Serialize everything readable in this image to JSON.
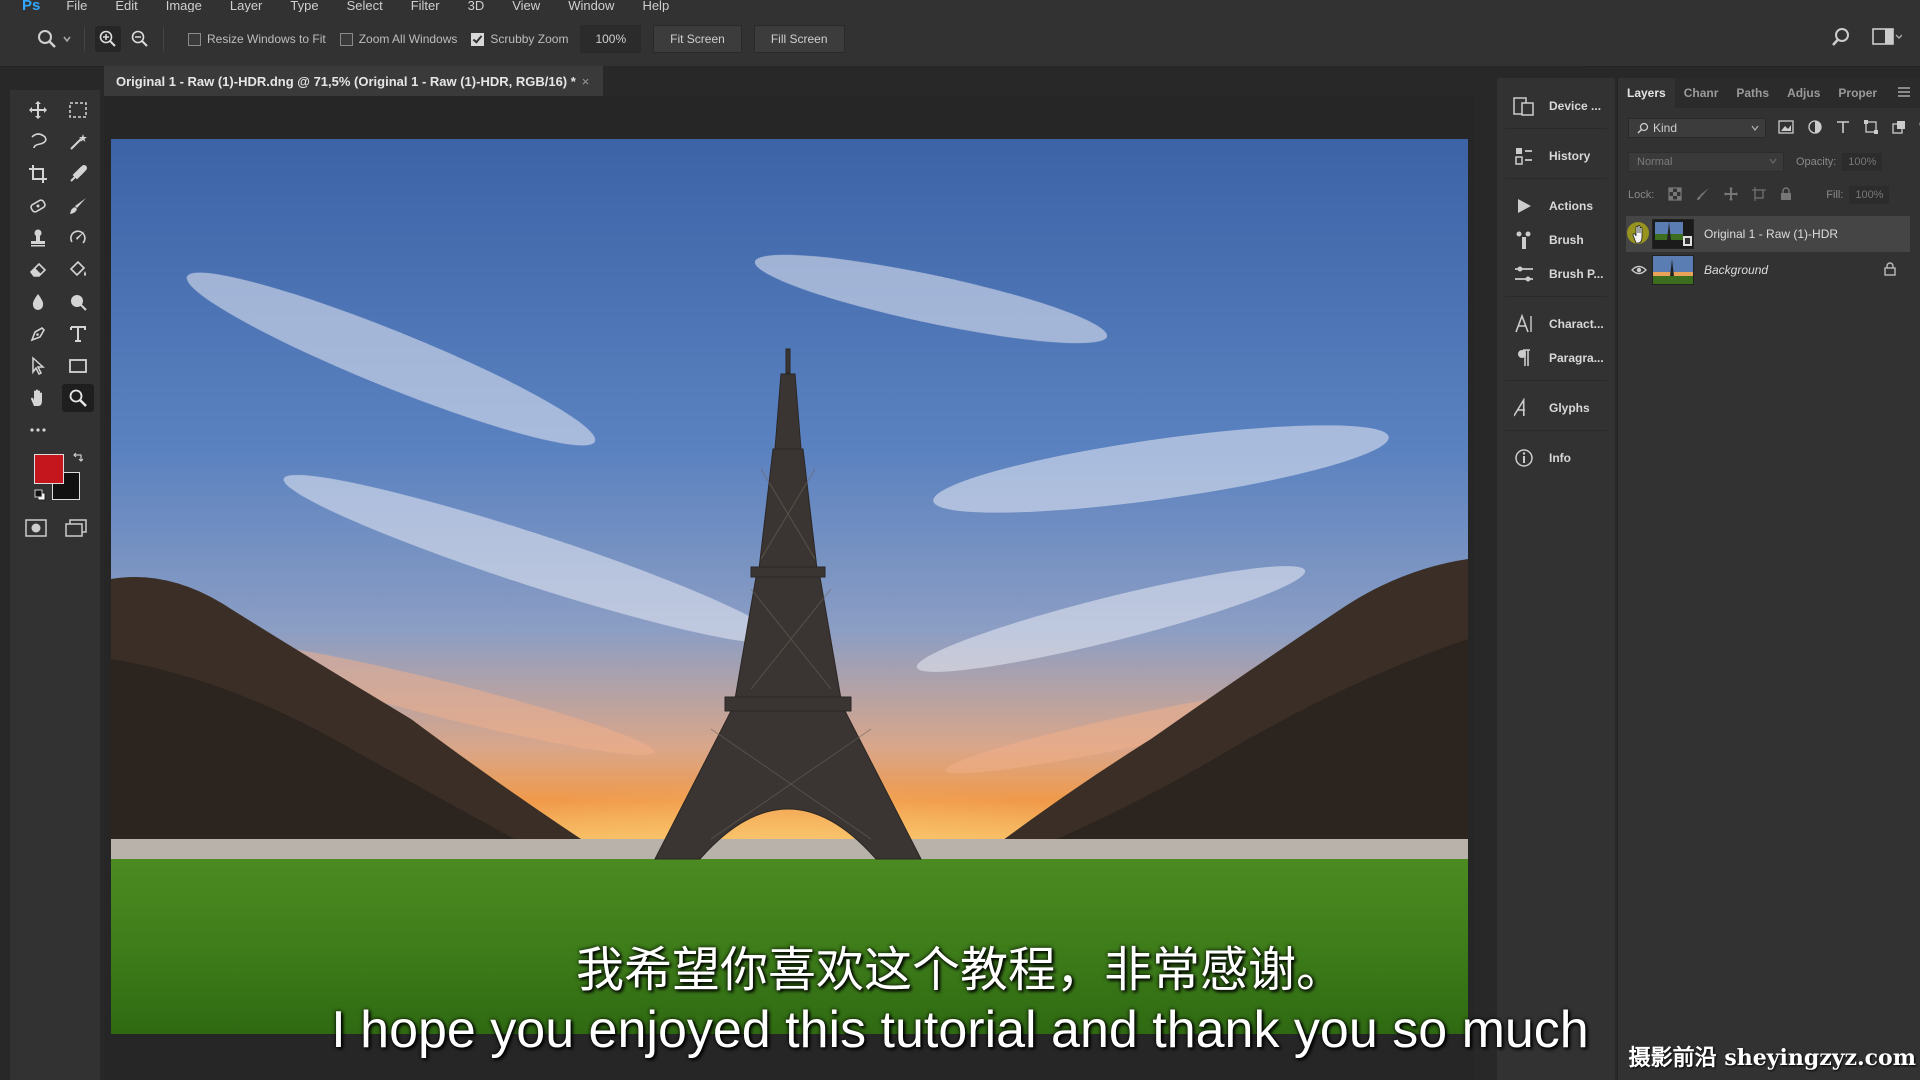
{
  "menubar": {
    "logo": "Ps",
    "items": [
      "File",
      "Edit",
      "Image",
      "Layer",
      "Type",
      "Select",
      "Filter",
      "3D",
      "View",
      "Window",
      "Help"
    ]
  },
  "options": {
    "resize_windows": {
      "label": "Resize Windows to Fit",
      "checked": false
    },
    "zoom_all": {
      "label": "Zoom All Windows",
      "checked": false
    },
    "scrubby": {
      "label": "Scrubby Zoom",
      "checked": true
    },
    "zoom_value": "100%",
    "fit_screen": "Fit Screen",
    "fill_screen": "Fill Screen"
  },
  "document": {
    "tab_title": "Original 1 - Raw (1)-HDR.dng @ 71,5% (Original 1 - Raw (1)-HDR, RGB/16) *",
    "close": "×"
  },
  "colors": {
    "foreground": "#c4161c",
    "background": "#111111",
    "accent": "#31a8ff"
  },
  "panels_collapsed": [
    {
      "label": "Device ...",
      "icon": "device-preview-icon"
    },
    {
      "label": "History",
      "icon": "history-icon"
    },
    {
      "label": "Actions",
      "icon": "actions-play-icon"
    },
    {
      "label": "Brush",
      "icon": "brush-icon"
    },
    {
      "label": "Brush P...",
      "icon": "brush-presets-icon"
    },
    {
      "label": "Charact...",
      "icon": "character-icon"
    },
    {
      "label": "Paragra...",
      "icon": "paragraph-icon"
    },
    {
      "label": "Glyphs",
      "icon": "glyphs-icon"
    },
    {
      "label": "Info",
      "icon": "info-icon"
    }
  ],
  "layers_panel": {
    "tabs": [
      "Layers",
      "Chanr",
      "Paths",
      "Adjus",
      "Proper"
    ],
    "kind": "Kind",
    "blend_mode": "Normal",
    "opacity_label": "Opacity:",
    "opacity_value": "100%",
    "lock_label": "Lock:",
    "fill_label": "Fill:",
    "fill_value": "100%",
    "layers": [
      {
        "name": "Original 1 - Raw (1)-HDR",
        "selected": true,
        "visible": false
      },
      {
        "name": "Background",
        "selected": false,
        "visible": true,
        "locked": true
      }
    ]
  },
  "subtitles": {
    "cn": "我希望你喜欢这个教程，非常感谢。",
    "en": "I hope you enjoyed this tutorial and thank you so much"
  },
  "watermark": "摄影前沿 sheyingzyz.com"
}
